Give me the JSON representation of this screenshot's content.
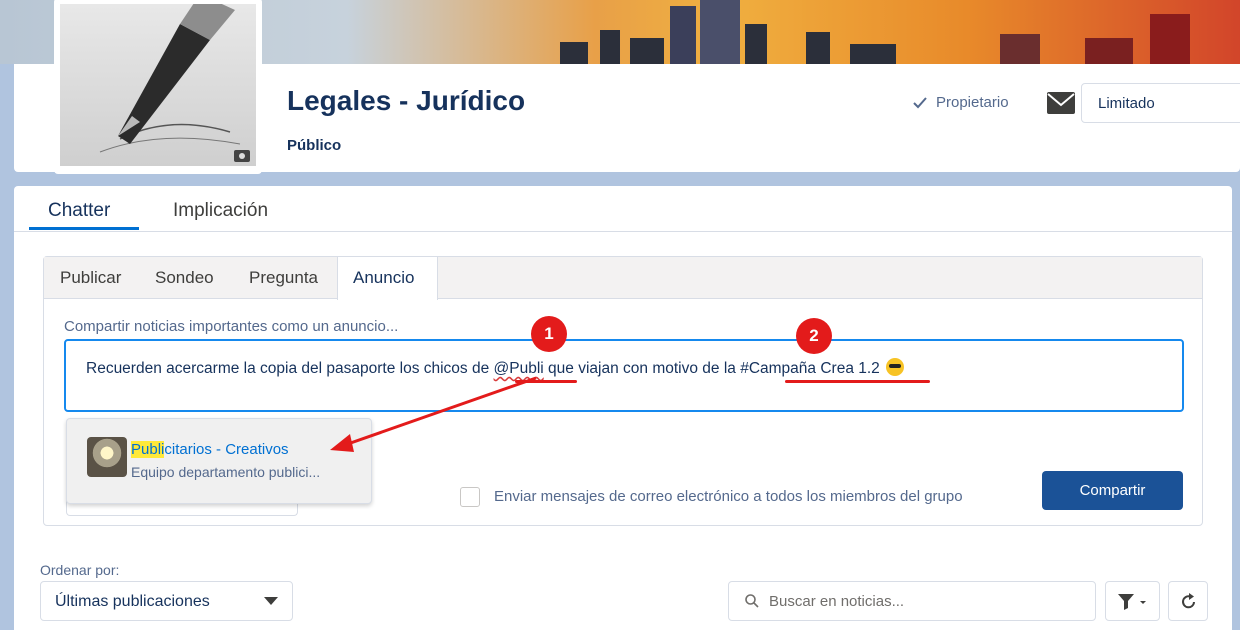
{
  "group": {
    "title": "Legales - Jurídico",
    "access": "Público",
    "owner_label": "Propietario",
    "notification_value": "Limitado"
  },
  "main_tabs": [
    {
      "label": "Chatter"
    },
    {
      "label": "Implicación"
    }
  ],
  "publisher": {
    "tabs": [
      {
        "label": "Publicar"
      },
      {
        "label": "Sondeo"
      },
      {
        "label": "Pregunta"
      },
      {
        "label": "Anuncio"
      }
    ],
    "active_tab": "Anuncio",
    "input_label": "Compartir noticias importantes como un anuncio...",
    "text_before": "Recuerden acercarme la copia del pasaporte los chicos de ",
    "mention": "@Publi",
    "text_middle": " que viajan con motivo de la ",
    "hashtag": "#Campaña Crea 1.2",
    "emoji": "smiling-face-with-sunglasses",
    "email_label": "Enviar mensajes de correo electrónico a todos los miembros del grupo",
    "share_label": "Compartir"
  },
  "suggestion": {
    "title_highlight": "Publi",
    "title_rest": "citarios - Creativos",
    "subtitle": "Equipo departamento publici..."
  },
  "annotations": {
    "badge1": "1",
    "badge2": "2",
    "color": "#e31b1b"
  },
  "feed": {
    "sort_label": "Ordenar por:",
    "sort_value": "Últimas publicaciones",
    "search_placeholder": "Buscar en noticias..."
  },
  "colors": {
    "brand_blue": "#0070d2",
    "share_button": "#1b5297",
    "text_primary": "#16325c"
  }
}
